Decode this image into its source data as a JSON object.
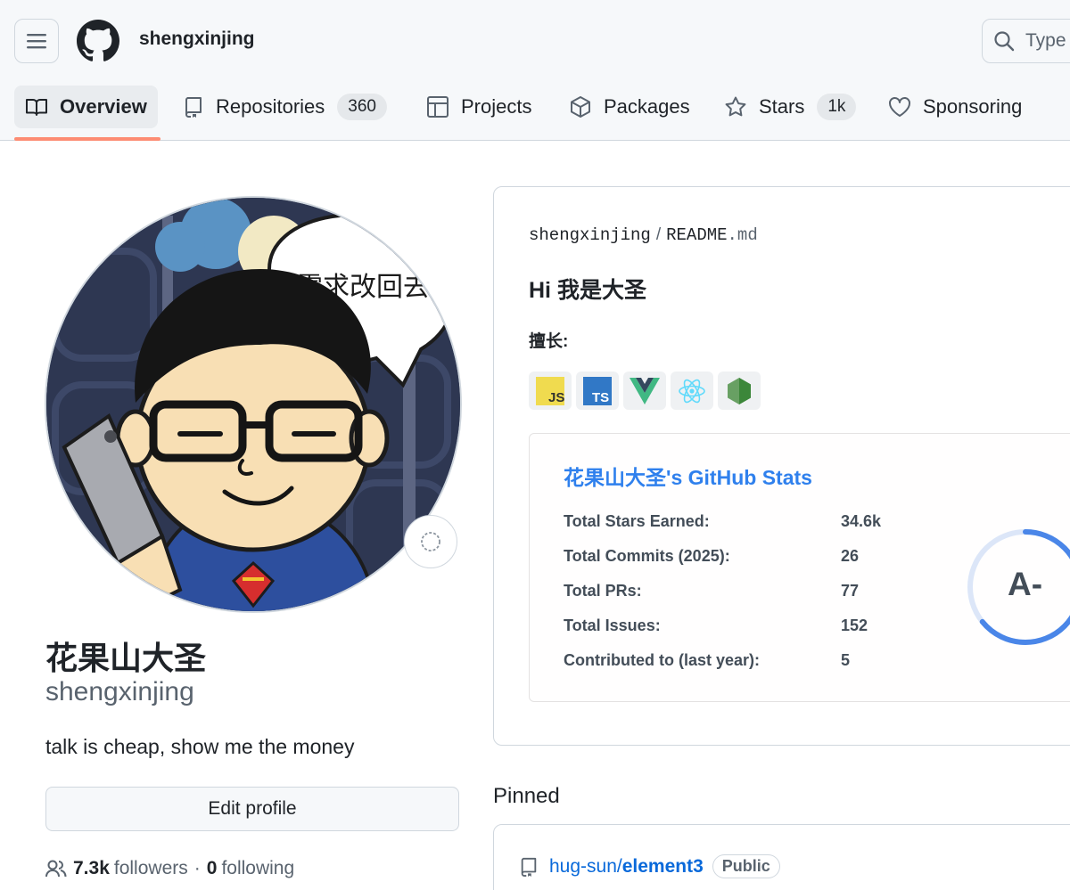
{
  "header": {
    "username": "shengxinjing",
    "search_placeholder": "Type"
  },
  "tabs": [
    {
      "label": "Overview",
      "icon": "book-icon",
      "active": true
    },
    {
      "label": "Repositories",
      "icon": "repo-icon",
      "count": "360"
    },
    {
      "label": "Projects",
      "icon": "table-icon"
    },
    {
      "label": "Packages",
      "icon": "package-icon"
    },
    {
      "label": "Stars",
      "icon": "star-icon",
      "count": "1k"
    },
    {
      "label": "Sponsoring",
      "icon": "heart-icon"
    }
  ],
  "profile": {
    "avatar_speech": "需求改回去",
    "display_name": "花果山大圣",
    "login": "shengxinjing",
    "bio": "talk is cheap, show me the money",
    "edit_label": "Edit profile",
    "followers_count": "7.3k",
    "followers_label": "followers",
    "separator": "·",
    "following_count": "0",
    "following_label": "following"
  },
  "readme": {
    "owner": "shengxinjing",
    "slash": "/",
    "file": "README",
    "ext": ".md",
    "heading": "Hi 我是大圣",
    "skills_label": "擅长:",
    "badges": [
      {
        "name": "javascript-logo",
        "text": "JS",
        "color": "#f0db4f"
      },
      {
        "name": "typescript-logo",
        "text": "TS",
        "color": "#3178c6"
      },
      {
        "name": "vue-logo",
        "color": "#41b883"
      },
      {
        "name": "react-logo",
        "color": "#61dafb"
      },
      {
        "name": "nodejs-logo",
        "color": "#68a063"
      }
    ],
    "stats": {
      "title": "花果山大圣's GitHub Stats",
      "rows": [
        {
          "label": "Total Stars Earned:",
          "value": "34.6k"
        },
        {
          "label": "Total Commits (2025):",
          "value": "26"
        },
        {
          "label": "Total PRs:",
          "value": "77"
        },
        {
          "label": "Total Issues:",
          "value": "152"
        },
        {
          "label": "Contributed to (last year):",
          "value": "5"
        }
      ],
      "rank": "A-",
      "title_color": "#2f80ed",
      "ring_color": "#4a86e8"
    }
  },
  "pinned": {
    "heading": "Pinned",
    "items": [
      {
        "owner": "hug-sun/",
        "repo": "element3",
        "visibility": "Public"
      }
    ]
  }
}
